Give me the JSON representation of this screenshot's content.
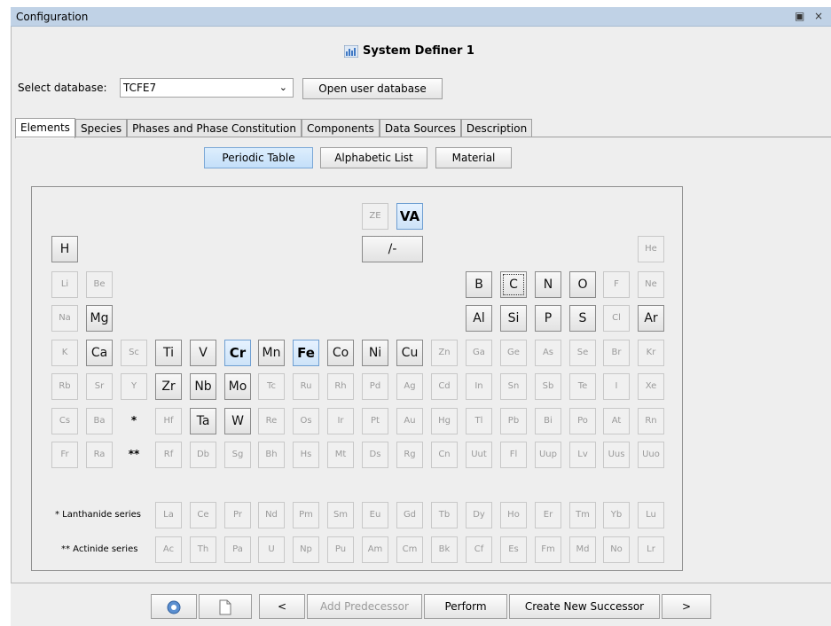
{
  "window": {
    "title": "Configuration",
    "restore_glyph": "▣",
    "close_glyph": "×"
  },
  "header": {
    "title": "System Definer 1",
    "icon": "system-definer-icon"
  },
  "database": {
    "label": "Select database:",
    "value": "TCFE7",
    "open_user_label": "Open user database",
    "arrow": "⌄"
  },
  "tabs": [
    {
      "label": "Elements",
      "active": true
    },
    {
      "label": "Species"
    },
    {
      "label": "Phases and Phase Constitution"
    },
    {
      "label": "Components"
    },
    {
      "label": "Data Sources"
    },
    {
      "label": "Description"
    }
  ],
  "view_buttons": {
    "periodic": "Periodic Table",
    "alphabetic": "Alphabetic List",
    "material": "Material"
  },
  "special": {
    "ze": "ZE",
    "va": "VA",
    "slash": "/-"
  },
  "rows": [
    [
      "H",
      "",
      "",
      "",
      "",
      "",
      "",
      "",
      "",
      "",
      "",
      "",
      "",
      "",
      "",
      "",
      "",
      "He"
    ],
    [
      "Li",
      "Be",
      "",
      "",
      "",
      "",
      "",
      "",
      "",
      "",
      "",
      "",
      "B",
      "C",
      "N",
      "O",
      "F",
      "Ne"
    ],
    [
      "Na",
      "Mg",
      "",
      "",
      "",
      "",
      "",
      "",
      "",
      "",
      "",
      "",
      "Al",
      "Si",
      "P",
      "S",
      "Cl",
      "Ar"
    ],
    [
      "K",
      "Ca",
      "Sc",
      "Ti",
      "V",
      "Cr",
      "Mn",
      "Fe",
      "Co",
      "Ni",
      "Cu",
      "Zn",
      "Ga",
      "Ge",
      "As",
      "Se",
      "Br",
      "Kr"
    ],
    [
      "Rb",
      "Sr",
      "Y",
      "Zr",
      "Nb",
      "Mo",
      "Tc",
      "Ru",
      "Rh",
      "Pd",
      "Ag",
      "Cd",
      "In",
      "Sn",
      "Sb",
      "Te",
      "I",
      "Xe"
    ],
    [
      "Cs",
      "Ba",
      "*",
      "Hf",
      "Ta",
      "W",
      "Re",
      "Os",
      "Ir",
      "Pt",
      "Au",
      "Hg",
      "Tl",
      "Pb",
      "Bi",
      "Po",
      "At",
      "Rn"
    ],
    [
      "Fr",
      "Ra",
      "**",
      "Rf",
      "Db",
      "Sg",
      "Bh",
      "Hs",
      "Mt",
      "Ds",
      "Rg",
      "Cn",
      "Uut",
      "Fl",
      "Uup",
      "Lv",
      "Uus",
      "Uuo"
    ]
  ],
  "lanthanides": {
    "label": "* Lanthanide series",
    "elements": [
      "La",
      "Ce",
      "Pr",
      "Nd",
      "Pm",
      "Sm",
      "Eu",
      "Gd",
      "Tb",
      "Dy",
      "Ho",
      "Er",
      "Tm",
      "Yb",
      "Lu"
    ]
  },
  "actinides": {
    "label": "** Actinide series",
    "elements": [
      "Ac",
      "Th",
      "Pa",
      "U",
      "Np",
      "Pu",
      "Am",
      "Cm",
      "Bk",
      "Cf",
      "Es",
      "Fm",
      "Md",
      "No",
      "Lr"
    ]
  },
  "available": [
    "H",
    "Mg",
    "Ca",
    "Ti",
    "V",
    "Mn",
    "Co",
    "Ni",
    "Cu",
    "Zr",
    "Nb",
    "Mo",
    "Ta",
    "W",
    "B",
    "C",
    "N",
    "O",
    "Al",
    "Si",
    "P",
    "S",
    "Ar",
    "/-"
  ],
  "selected": [
    "VA",
    "Cr",
    "Fe"
  ],
  "focused": "C",
  "bottom": {
    "help_icon": "help-icon",
    "doc_icon": "document-icon",
    "prev": "<",
    "add_predecessor": "Add Predecessor",
    "perform": "Perform",
    "create_successor": "Create New Successor",
    "next": ">"
  }
}
